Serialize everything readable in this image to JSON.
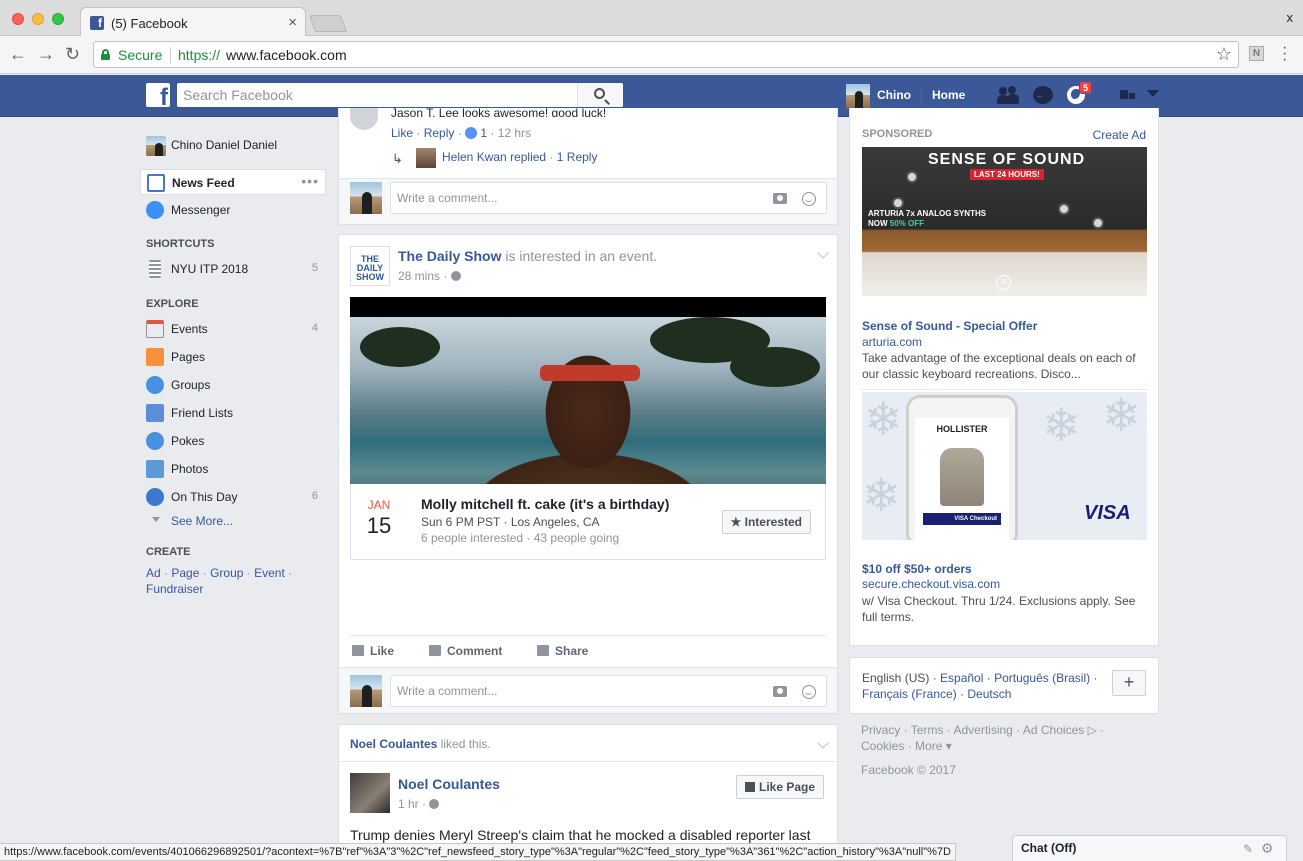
{
  "browser": {
    "tab_title": "(5) Facebook",
    "tab_close": "×",
    "window_close": "x",
    "secure_label": "Secure",
    "url_scheme": "https://",
    "url_host": "www.facebook.com",
    "extension_letter": "N",
    "status_url": "https://www.facebook.com/events/401066296892501/?acontext=%7B\"ref\"%3A\"3\"%2C\"ref_newsfeed_story_type\"%3A\"regular\"%2C\"feed_story_type\"%3A\"361\"%2C\"action_history\"%3A\"null\"%7D"
  },
  "topbar": {
    "search_placeholder": "Search Facebook",
    "user_name": "Chino",
    "home_label": "Home",
    "notifications_count": "5"
  },
  "left_nav": {
    "profile_name": "Chino Daniel Daniel",
    "news_feed": "News Feed",
    "more_dots": "•••",
    "messenger": "Messenger",
    "shortcuts_heading": "SHORTCUTS",
    "shortcut_item": "NYU ITP 2018",
    "shortcut_count": "5",
    "explore_heading": "EXPLORE",
    "explore": [
      {
        "label": "Events",
        "count": "4",
        "icon": "calendar-icon",
        "color": "#e9ebee"
      },
      {
        "label": "Pages",
        "count": "",
        "icon": "flag-icon",
        "color": "#f7923b"
      },
      {
        "label": "Groups",
        "count": "",
        "icon": "groups-icon",
        "color": "#4a90e2"
      },
      {
        "label": "Friend Lists",
        "count": "",
        "icon": "friend-list-icon",
        "color": "#5b8dd9"
      },
      {
        "label": "Pokes",
        "count": "",
        "icon": "poke-icon",
        "color": "#4a90e2"
      },
      {
        "label": "Photos",
        "count": "",
        "icon": "photos-icon",
        "color": "#5b9bd5"
      },
      {
        "label": "On This Day",
        "count": "6",
        "icon": "clock-icon",
        "color": "#3b79cc"
      }
    ],
    "see_more": "See More...",
    "create_heading": "CREATE",
    "create_links": [
      "Ad",
      "Page",
      "Group",
      "Event",
      "Fundraiser"
    ]
  },
  "feed": {
    "top_comment_cut": "Jason T. Lee looks awesome! good luck!",
    "comment_like": "Like",
    "comment_reply": "Reply",
    "comment_reactions": "1",
    "comment_time": "12 hrs",
    "reply_name": "Helen Kwan",
    "reply_text": "replied",
    "reply_count": "1 Reply",
    "write_placeholder": "Write a comment...",
    "post1": {
      "page_name": "The Daily Show",
      "page_logo_text": "THE DAILY SHOW",
      "action_text": "is interested in an event.",
      "time": "28 mins",
      "event_month": "JAN",
      "event_day": "15",
      "event_title": "Molly mitchell ft. cake (it's a birthday)",
      "event_when": "Sun 6 PM PST · Los Angeles, CA",
      "event_stats": "6 people interested · 43 people going",
      "interested_label": "Interested",
      "like": "Like",
      "comment": "Comment",
      "share": "Share"
    },
    "post2": {
      "liker": "Noel Coulantes",
      "liked_text": "liked this.",
      "page_name": "Noel Coulantes",
      "time": "1 hr",
      "like_page_label": "Like Page",
      "body": "Trump denies Meryl Streep's claim that he mocked a disabled reporter last"
    }
  },
  "right": {
    "sponsored": "SPONSORED",
    "create_ad": "Create Ad",
    "ad1": {
      "banner_title": "SENSE OF SOUND",
      "banner_badge": "LAST 24 HOURS!",
      "banner_line1": "ARTURIA 7x ANALOG SYNTHS",
      "banner_line2_prefix": "NOW",
      "banner_line2_highlight": "50% OFF",
      "title": "Sense of Sound - Special Offer",
      "domain": "arturia.com",
      "desc": "Take advantage of the exceptional deals on each of our classic keyboard recreations. Disco..."
    },
    "ad2": {
      "brand": "HOLLISTER",
      "checkout": "VISA Checkout",
      "visa": "VISA",
      "title": "$10 off $50+ orders",
      "domain": "secure.checkout.visa.com",
      "desc": "w/ Visa Checkout. Thru 1/24. Exclusions apply. See full terms."
    },
    "languages": {
      "current": "English (US)",
      "others_line1": [
        "Español",
        "Português (Brasil)"
      ],
      "others_line2": [
        "Français (France)",
        "Deutsch"
      ],
      "add_label": "+"
    },
    "footer_line1": [
      "Privacy",
      "Terms",
      "Advertising",
      "Ad Choices"
    ],
    "footer_line2": [
      "Cookies",
      "More"
    ],
    "copyright": "Facebook © 2017"
  },
  "chat": {
    "label": "Chat (Off)"
  }
}
